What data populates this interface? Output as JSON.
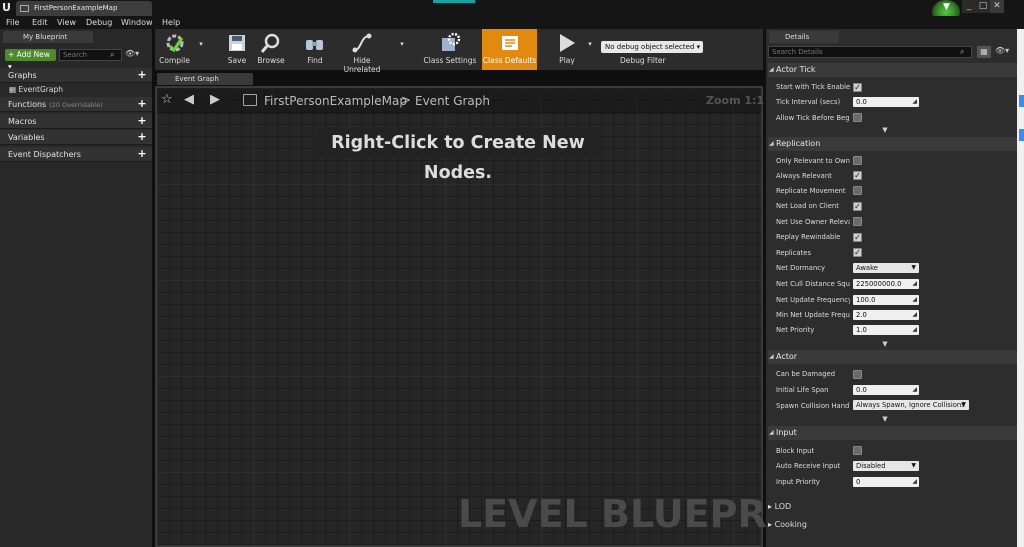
{
  "window": {
    "tab_title": "FirstPersonExampleMap",
    "logo": "U",
    "notification": "▼",
    "controls": [
      "_",
      "□",
      "✕"
    ]
  },
  "menu": [
    "File",
    "Edit",
    "View",
    "Debug",
    "Window",
    "Help"
  ],
  "left_panel": {
    "tab": "My Blueprint",
    "add_new": "Add New",
    "search_placeholder": "Search",
    "sections": [
      {
        "label": "Graphs"
      },
      {
        "label": "Functions",
        "sub": "(20 Overridable)"
      },
      {
        "label": "Macros"
      },
      {
        "label": "Variables"
      },
      {
        "label": "Event Dispatchers"
      }
    ],
    "event_graph_item": "EventGraph"
  },
  "toolbar": {
    "compile": "Compile",
    "save": "Save",
    "browse": "Browse",
    "find": "Find",
    "hide_unrelated": "Hide Unrelated",
    "class_settings": "Class Settings",
    "class_defaults": "Class Defaults",
    "play": "Play",
    "debug_object": "No debug object selected",
    "debug_filter": "Debug Filter"
  },
  "graph": {
    "tab": "Event Graph",
    "breadcrumb_map": "FirstPersonExampleMap",
    "breadcrumb_sep": ">",
    "breadcrumb_graph": "Event Graph",
    "zoom": "Zoom 1:1",
    "hint": "Right-Click to Create New Nodes.",
    "watermark": "LEVEL BLUEPRINT"
  },
  "details": {
    "tab": "Details",
    "search_placeholder": "Search Details",
    "actor_tick": {
      "header": "Actor Tick",
      "start_with_tick": "Start with Tick Enabled",
      "tick_interval_label": "Tick Interval (secs)",
      "tick_interval": "0.0",
      "allow_tick": "Allow Tick Before Begin"
    },
    "replication": {
      "header": "Replication",
      "only_relevant": "Only Relevant to Owner",
      "always_relevant": "Always Relevant",
      "replicate_movement": "Replicate Movement",
      "net_load": "Net Load on Client",
      "net_use_owner": "Net Use Owner Relevancy",
      "replay_rewindable": "Replay Rewindable",
      "replicates": "Replicates",
      "net_dormancy_label": "Net Dormancy",
      "net_dormancy": "Awake",
      "net_cull_label": "Net Cull Distance Squared",
      "net_cull": "225000000.0",
      "net_update_label": "Net Update Frequency",
      "net_update": "100.0",
      "min_net_update_label": "Min Net Update Frequency",
      "min_net_update": "2.0",
      "net_priority_label": "Net Priority",
      "net_priority": "1.0"
    },
    "actor": {
      "header": "Actor",
      "can_be_damaged": "Can be Damaged",
      "life_span_label": "Initial Life Span",
      "life_span": "0.0",
      "spawn_label": "Spawn Collision Handling",
      "spawn": "Always Spawn, Ignore Collisions"
    },
    "input": {
      "header": "Input",
      "block_input": "Block Input",
      "auto_receive_label": "Auto Receive Input",
      "auto_receive": "Disabled",
      "priority_label": "Input Priority",
      "priority": "0"
    },
    "lod": "LOD",
    "cooking": "Cooking"
  },
  "colors": {
    "accent": "#e08a10",
    "add_new": "#4c8a2a",
    "checked": "#cfcfcf"
  }
}
